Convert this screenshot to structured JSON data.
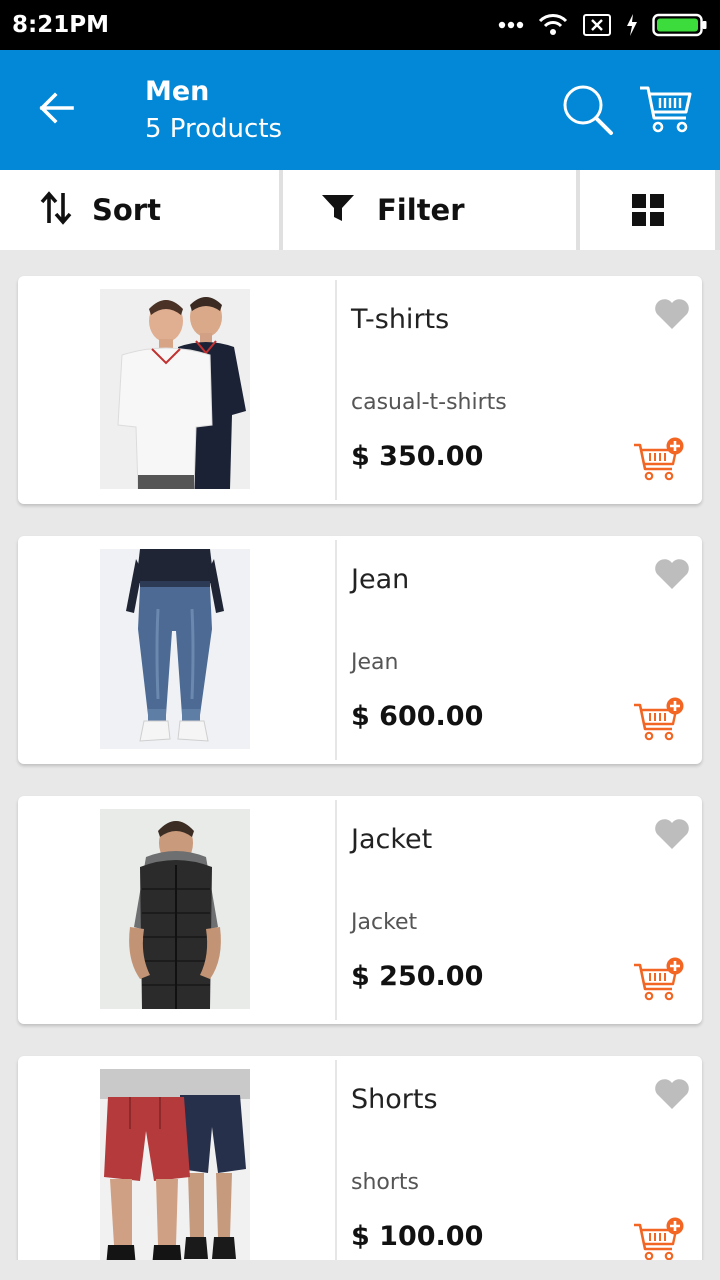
{
  "status_bar": {
    "time": "8:21PM"
  },
  "header": {
    "title": "Men",
    "subtitle": "5 Products"
  },
  "toolbar": {
    "sort_label": "Sort",
    "filter_label": "Filter"
  },
  "colors": {
    "app_bar": "#0288d6",
    "accent_cart": "#f26522",
    "heart": "#bdbdbd"
  },
  "products": [
    {
      "name": "T-shirts",
      "category": "casual-t-shirts",
      "price": "$ 350.00"
    },
    {
      "name": "Jean",
      "category": "Jean",
      "price": "$ 600.00"
    },
    {
      "name": "Jacket",
      "category": "Jacket",
      "price": "$ 250.00"
    },
    {
      "name": "Shorts",
      "category": "shorts",
      "price": "$ 100.00"
    }
  ]
}
